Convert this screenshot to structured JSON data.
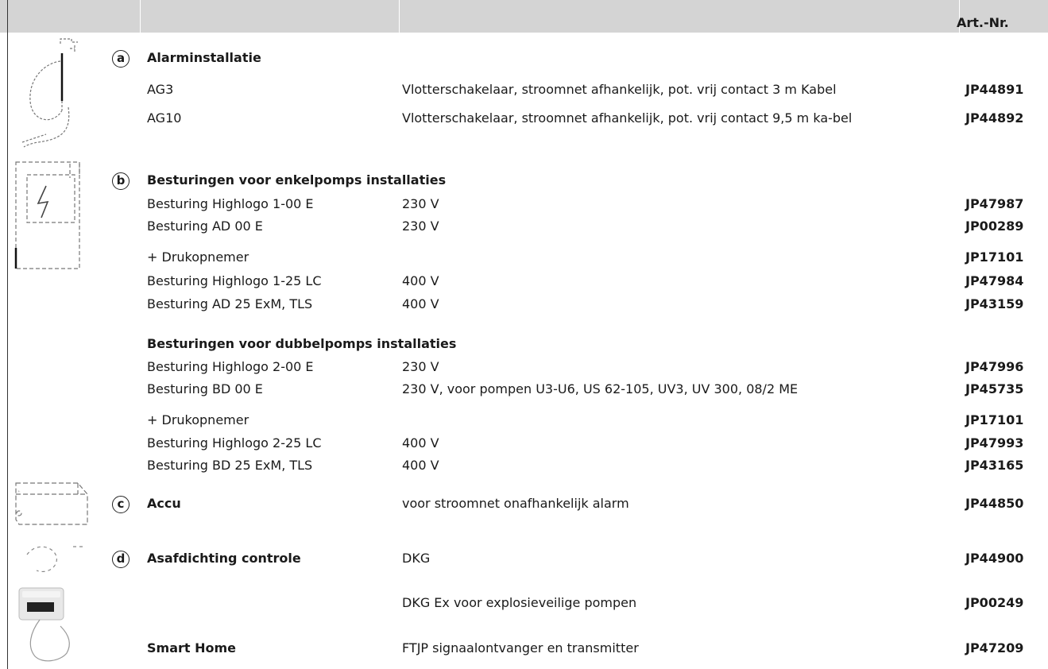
{
  "header": {
    "art_nr": "Art.-Nr."
  },
  "sections": {
    "a": {
      "letter": "a",
      "title": "Alarminstallatie"
    },
    "b": {
      "letter": "b",
      "title": "Besturingen voor enkelpomps installaties",
      "subtitle": "Besturingen voor dubbelpomps installaties"
    },
    "c": {
      "letter": "c",
      "title": "Accu"
    },
    "d": {
      "letter": "d",
      "title": "Asafdichting controle"
    },
    "smart": {
      "title": "Smart Home"
    }
  },
  "rows": [
    {
      "name": "AG3",
      "desc": "Vlotterschakelaar, stroomnet afhankelijk, pot. vrij contact 3 m Kabel",
      "art": "JP44891"
    },
    {
      "name": "AG10",
      "desc": "Vlotterschakelaar, stroomnet afhankelijk, pot. vrij contact 9,5 m ka-bel",
      "art": "JP44892"
    },
    {
      "name": "Besturing Highlogo 1-00 E",
      "desc": "230 V",
      "art": "JP47987"
    },
    {
      "name": "Besturing  AD 00 E",
      "desc": "230 V",
      "art": "JP00289"
    },
    {
      "name": "+ Drukopnemer",
      "desc": "",
      "art": "JP17101"
    },
    {
      "name": "Besturing Highlogo 1-25 LC",
      "desc": "400 V",
      "art": "JP47984"
    },
    {
      "name": "Besturing  AD 25 ExM, TLS",
      "desc": "400 V",
      "art": "JP43159"
    },
    {
      "name": "Besturing Highlogo 2-00 E",
      "desc": "230 V",
      "art": "JP47996"
    },
    {
      "name": "Besturing BD 00 E",
      "desc": "230 V, voor pompen U3-U6, US 62-105, UV3, UV 300, 08/2 ME",
      "art": "JP45735"
    },
    {
      "name": "+ Drukopnemer",
      "desc": "",
      "art": "JP17101"
    },
    {
      "name": "Besturing Highlogo 2-25 LC",
      "desc": "400 V",
      "art": "JP47993"
    },
    {
      "name": "Besturing BD 25 ExM, TLS",
      "desc": "400 V",
      "art": "JP43165"
    },
    {
      "name": "",
      "desc": "voor stroomnet onafhankelijk alarm",
      "art": "JP44850"
    },
    {
      "name": "",
      "desc": "DKG",
      "art": "JP44900"
    },
    {
      "name": "",
      "desc": "DKG Ex voor explosieveilige pompen",
      "art": "JP00249"
    },
    {
      "name": "",
      "desc": "FTJP signaalontvanger en transmitter",
      "art": "JP47209"
    }
  ],
  "icons": {
    "a": "float-switch-cable-icon",
    "b": "control-box-lightning-icon",
    "c": "battery-icon",
    "d": "seal-monitor-icon",
    "smart": "smart-home-device-icon"
  }
}
